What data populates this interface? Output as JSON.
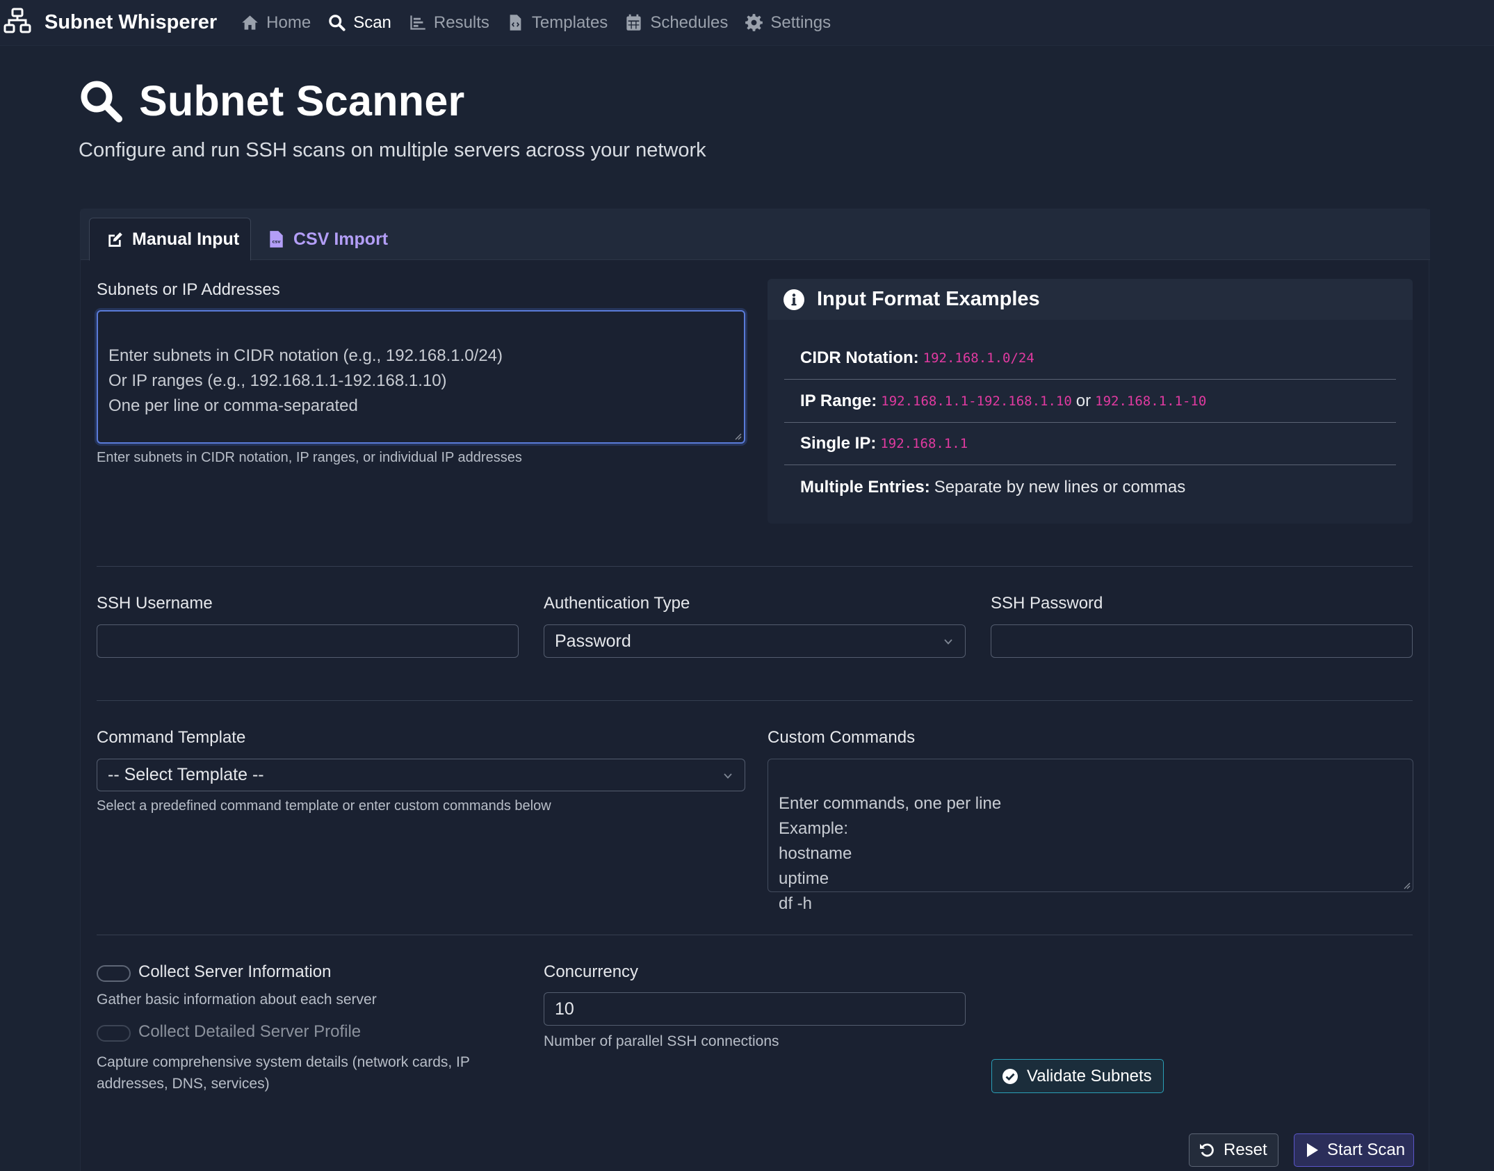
{
  "navbar": {
    "brand": "Subnet Whisperer",
    "items": [
      {
        "label": "Home",
        "icon": "home-icon"
      },
      {
        "label": "Scan",
        "icon": "search-icon",
        "active": true
      },
      {
        "label": "Results",
        "icon": "chart-bar-icon"
      },
      {
        "label": "Templates",
        "icon": "file-code-icon"
      },
      {
        "label": "Schedules",
        "icon": "calendar-icon"
      },
      {
        "label": "Settings",
        "icon": "gear-icon"
      }
    ]
  },
  "header": {
    "title": "Subnet Scanner",
    "subtitle": "Configure and run SSH scans on multiple servers across your network"
  },
  "tabs": [
    {
      "label": "Manual Input",
      "icon": "edit-icon",
      "active": true
    },
    {
      "label": "CSV Import",
      "icon": "csv-file-icon",
      "active": false
    }
  ],
  "subnets": {
    "label": "Subnets or IP Addresses",
    "placeholder": "Enter subnets in CIDR notation (e.g., 192.168.1.0/24)\nOr IP ranges (e.g., 192.168.1.1-192.168.1.10)\nOne per line or comma-separated",
    "value": "",
    "help": "Enter subnets in CIDR notation, IP ranges, or individual IP addresses"
  },
  "examples": {
    "title": "Input Format Examples",
    "rows": [
      {
        "key": "CIDR Notation:",
        "code1": "192.168.1.0/24"
      },
      {
        "key": "IP Range:",
        "code1": "192.168.1.1-192.168.1.10",
        "or": "or",
        "code2": "192.168.1.1-10"
      },
      {
        "key": "Single IP:",
        "code1": "192.168.1.1"
      },
      {
        "key": "Multiple Entries:",
        "text": "Separate by new lines or commas"
      }
    ]
  },
  "auth": {
    "username_label": "SSH Username",
    "username_value": "",
    "type_label": "Authentication Type",
    "type_value": "Password",
    "password_label": "SSH Password",
    "password_value": ""
  },
  "commands": {
    "template_label": "Command Template",
    "template_value": "-- Select Template --",
    "template_help": "Select a predefined command template or enter custom commands below",
    "custom_label": "Custom Commands",
    "custom_placeholder": "Enter commands, one per line\nExample:\nhostname\nuptime\ndf -h"
  },
  "options": {
    "collect_info_label": "Collect Server Information",
    "collect_info_help": "Gather basic information about each server",
    "collect_info_on": false,
    "collect_profile_label": "Collect Detailed Server Profile",
    "collect_profile_help": "Capture comprehensive system details (network cards, IP addresses, DNS, services)",
    "collect_profile_on": false,
    "collect_profile_disabled": true,
    "concurrency_label": "Concurrency",
    "concurrency_value": "10",
    "concurrency_help": "Number of parallel SSH connections"
  },
  "buttons": {
    "validate": "Validate Subnets",
    "reset": "Reset",
    "start": "Start Scan"
  },
  "colors": {
    "background": "#1b2333",
    "code": "#e03aa0",
    "tab_link": "#b39ef7",
    "validate_border": "#2aa0b8",
    "start_border": "#5a56c9"
  }
}
